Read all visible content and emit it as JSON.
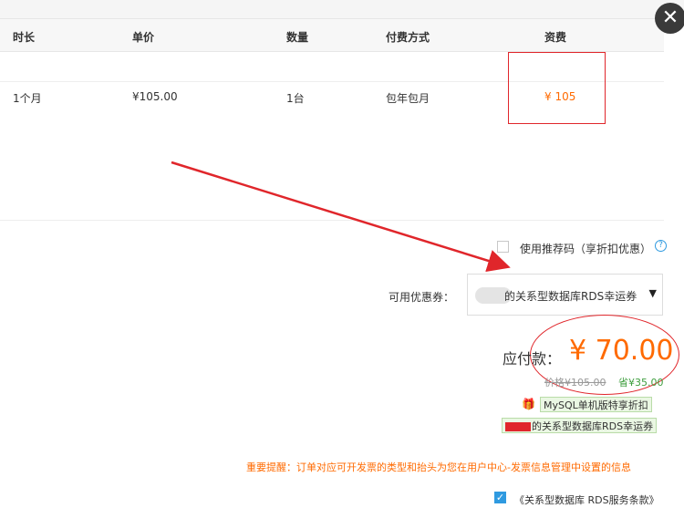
{
  "close_label": "✕",
  "table": {
    "headers": [
      "时长",
      "单价",
      "数量",
      "付费方式",
      "资费"
    ],
    "row": {
      "duration": "1个月",
      "unit_price": "¥105.00",
      "quantity": "1台",
      "billing": "包年包月",
      "fee": "¥ 105"
    }
  },
  "recommend_code": {
    "label": "使用推荐码（享折扣优惠）",
    "checked": false,
    "help_icon": "?"
  },
  "coupon": {
    "label": "可用优惠券：",
    "selected": "的关系型数据库RDS幸运券（",
    "arrow": "▼"
  },
  "payment": {
    "label": "应付款：",
    "amount": "¥ 70.00",
    "original": "价格¥105.00",
    "saved": "省¥35.00"
  },
  "promos": [
    {
      "icon": "gift-icon",
      "text": "MySQL单机版特享折扣"
    },
    {
      "icon": "",
      "text": "的关系型数据库RDS幸运券"
    }
  ],
  "notice": "重要提醒：订单对应可开发票的类型和抬头为您在用户中心-发票信息管理中设置的信息",
  "terms": {
    "checked": true,
    "text": "《关系型数据库 RDS服务条款》"
  },
  "colors": {
    "accent": "#ff6a00",
    "annotation_red": "#e0262b",
    "check_blue": "#2f9ae0",
    "promo_green": "#3e9e3e"
  }
}
